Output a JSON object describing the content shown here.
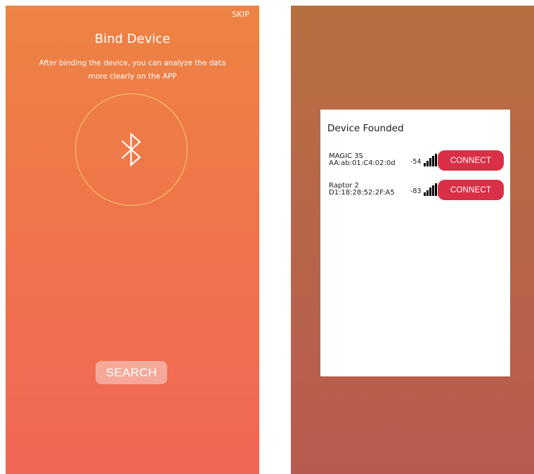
{
  "bind_screen": {
    "skip_label": "SKIP",
    "title": "Bind Device",
    "description_line1": "After binding the device, you can analyze the data",
    "description_line2": "more clearly on the APP",
    "center_icon": "bluetooth-icon",
    "search_label": "SEARCH",
    "colors": {
      "gradient_top": "#ee8343",
      "gradient_bottom": "#f06656",
      "ring": "#f9cf72"
    }
  },
  "devices_screen": {
    "panel_title": "Device Founded",
    "devices": [
      {
        "name": "MAGIC 3S",
        "mac": "AA:ab:01:C4:02:0d",
        "rssi": "-54",
        "signal_icon": "signal-strength-icon",
        "connect_label": "CONNECT"
      },
      {
        "name": "Raptor 2",
        "mac": "D1:18:28:52:2F:A5",
        "rssi": "-83",
        "signal_icon": "signal-strength-icon",
        "connect_label": "CONNECT"
      }
    ],
    "colors": {
      "background_top": "#b86f40",
      "background_bottom": "#b85b4e",
      "connect_button": "#d92f47"
    }
  }
}
